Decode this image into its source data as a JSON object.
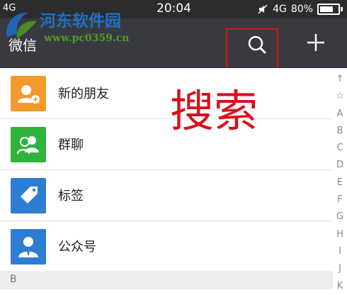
{
  "status_bar": {
    "signal_left": "4G",
    "time": "20:04",
    "network": "4G",
    "battery": "80%"
  },
  "title_bar": {
    "title": "微信"
  },
  "watermark": {
    "site_name": "河东软件园",
    "url": "www.pc0359.cn"
  },
  "list": [
    {
      "label": "新的朋友",
      "icon": "add-friend-icon",
      "color": "#f39a2b"
    },
    {
      "label": "群聊",
      "icon": "group-chat-icon",
      "color": "#2fb33b"
    },
    {
      "label": "标签",
      "icon": "tag-icon",
      "color": "#2d7dd2"
    },
    {
      "label": "公众号",
      "icon": "official-account-icon",
      "color": "#2d7dd2"
    }
  ],
  "section_header": "B",
  "annotation_text": "搜索",
  "index_bar": [
    "↑",
    "☆",
    "A",
    "B",
    "C",
    "D",
    "E",
    "F",
    "G",
    "H",
    "I",
    "J",
    "K"
  ],
  "colors": {
    "title_bar_bg": "#393a3f",
    "status_bar_bg": "#2c2c2c",
    "annotation_red": "#d9101c"
  }
}
